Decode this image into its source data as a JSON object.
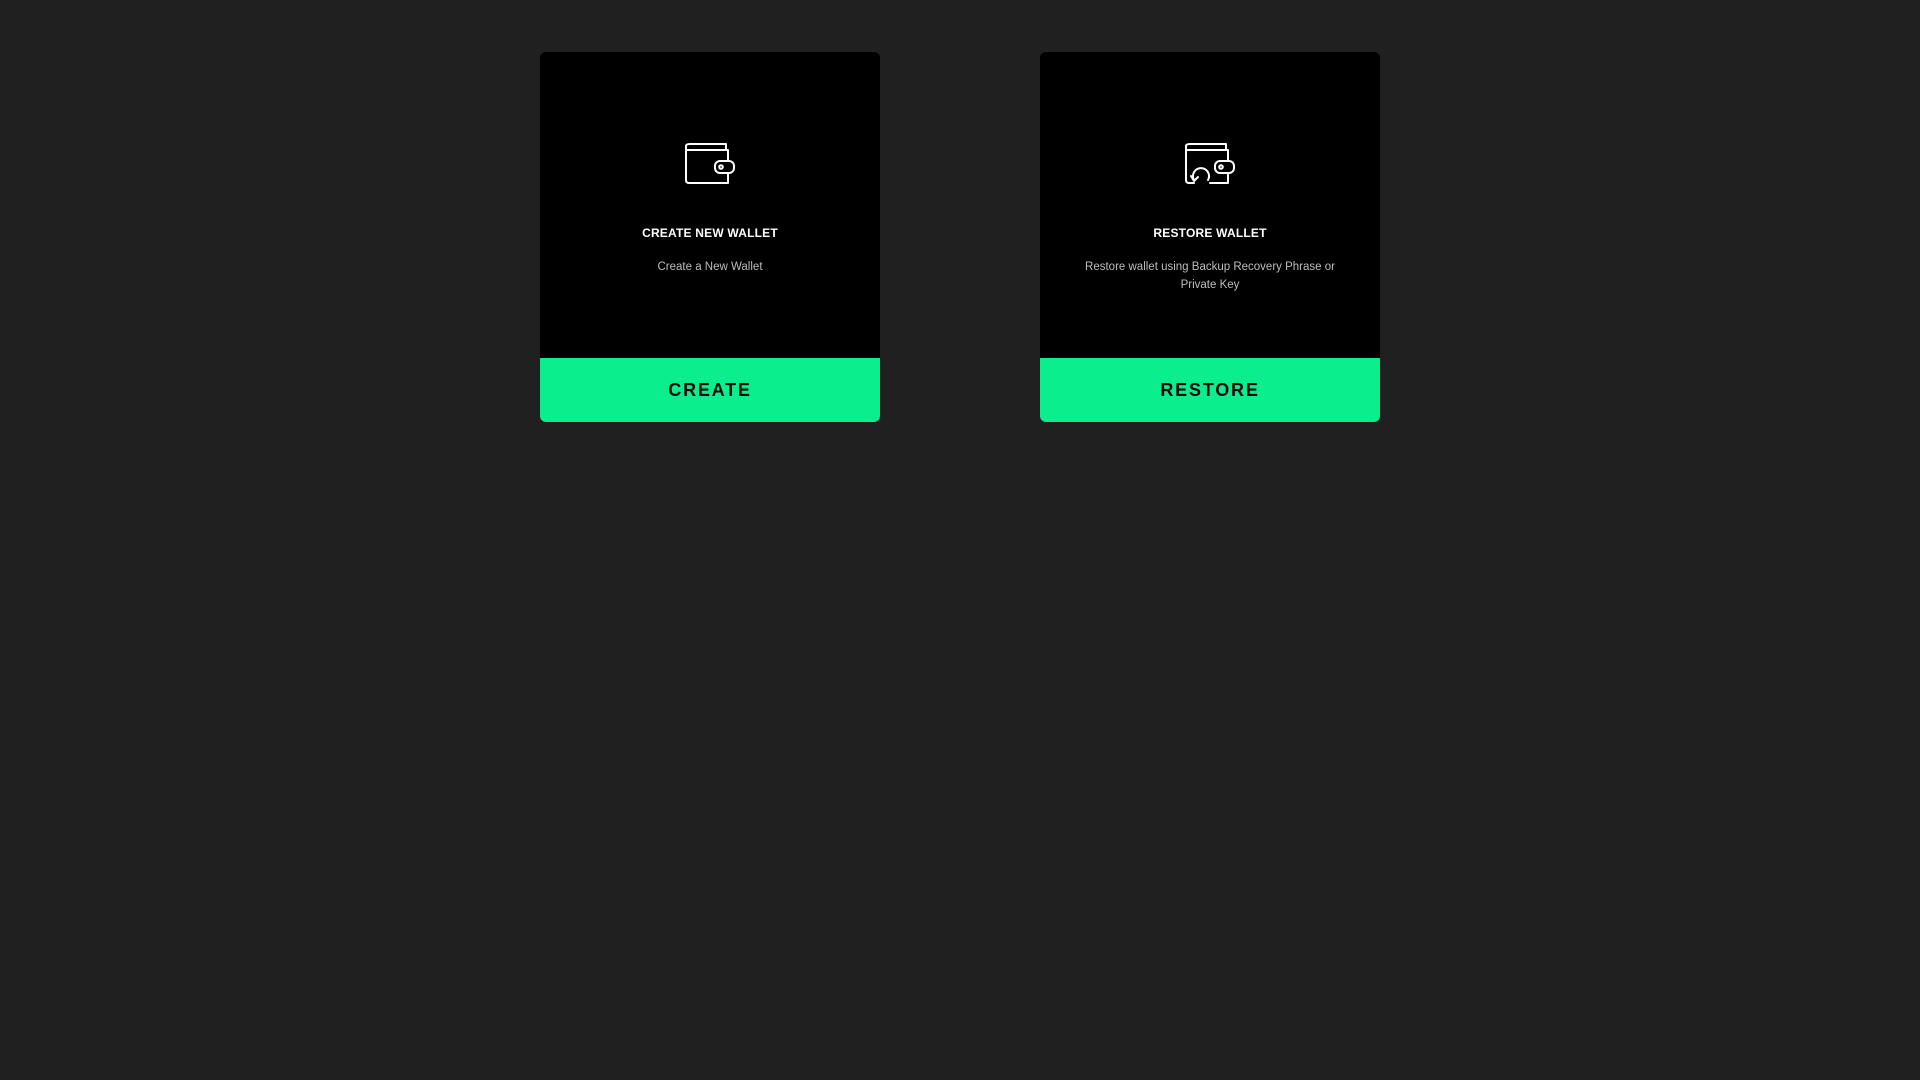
{
  "colors": {
    "page_background": "#202020",
    "card_background": "#000000",
    "accent": "#0bee8e"
  },
  "cards": [
    {
      "icon": "wallet-icon",
      "title": "CREATE NEW WALLET",
      "description": "Create a New Wallet",
      "button_label": "CREATE"
    },
    {
      "icon": "wallet-restore-icon",
      "title": "RESTORE WALLET",
      "description": "Restore wallet using Backup Recovery Phrase or Private Key",
      "button_label": "RESTORE"
    }
  ]
}
